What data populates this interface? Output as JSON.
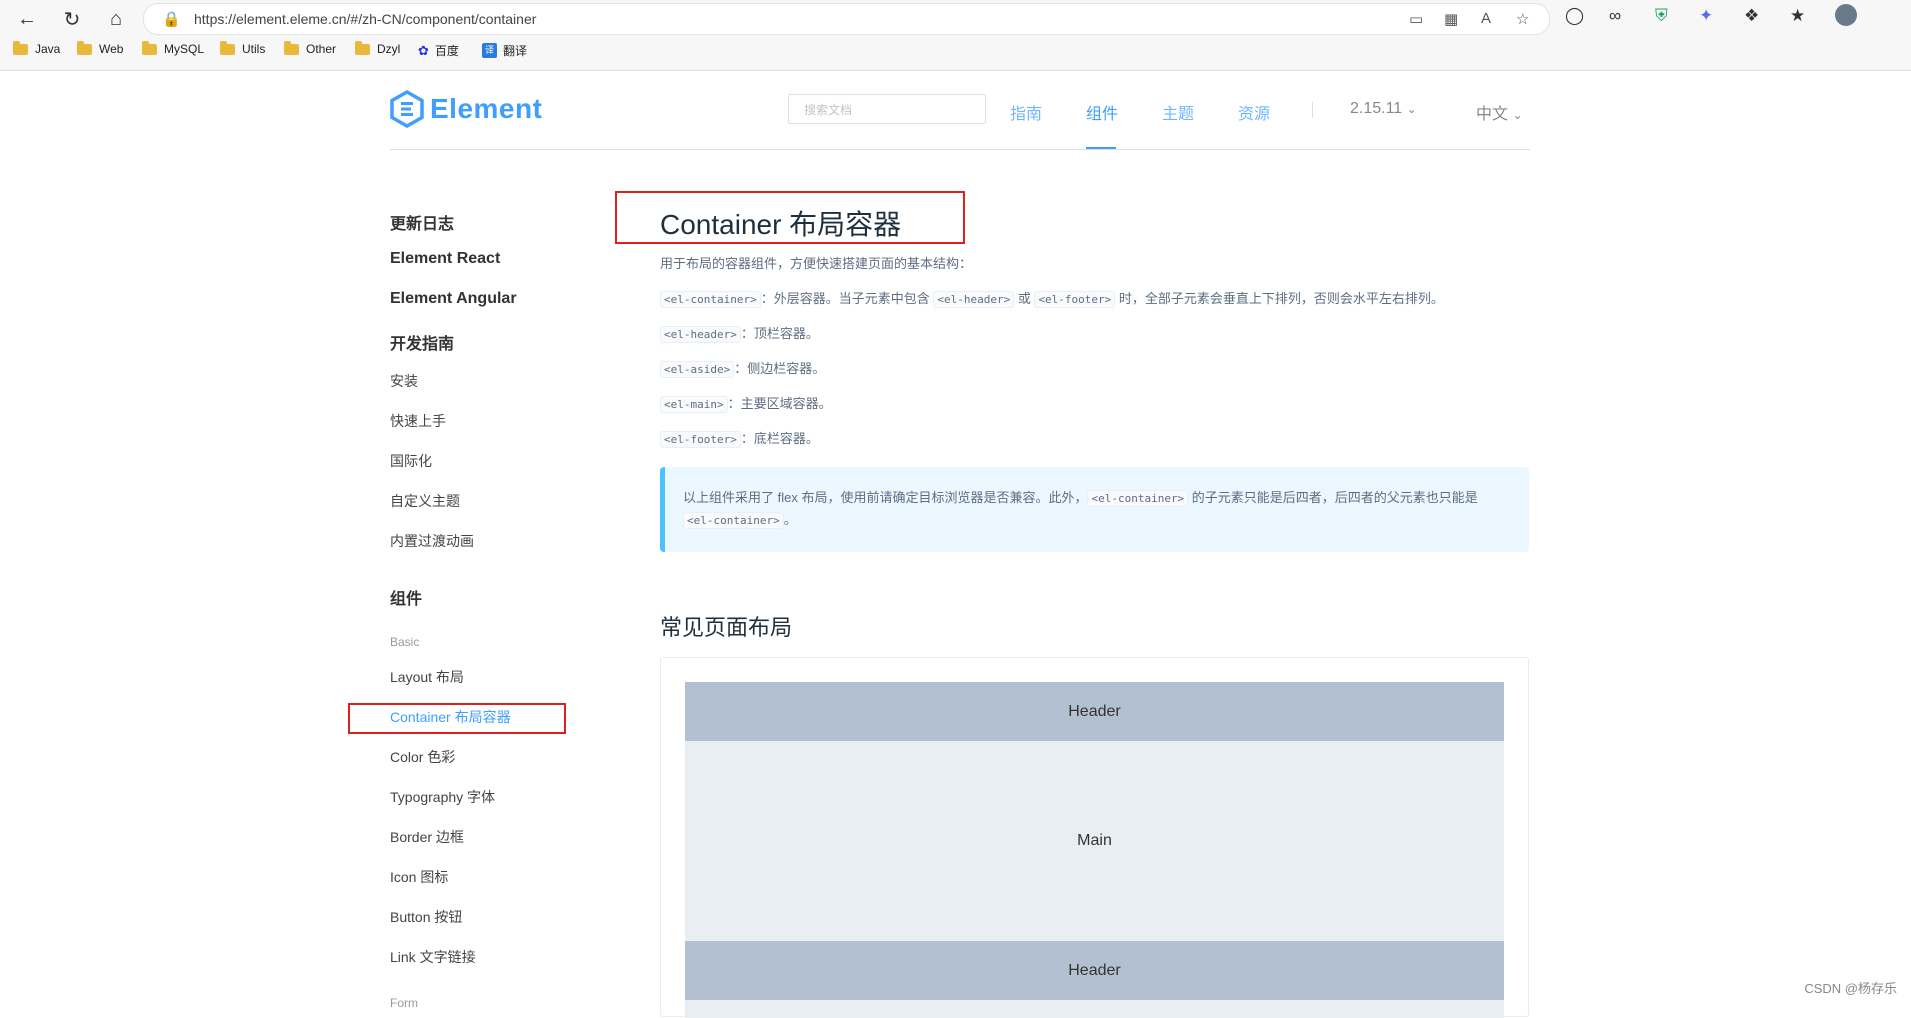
{
  "browser": {
    "url": "https://element.eleme.cn/#/zh-CN/component/container",
    "bookmarks": [
      {
        "label": "Java",
        "icon": "folder-icon"
      },
      {
        "label": "Web",
        "icon": "folder-icon"
      },
      {
        "label": "MySQL",
        "icon": "folder-icon"
      },
      {
        "label": "Utils",
        "icon": "folder-icon"
      },
      {
        "label": "Other",
        "icon": "folder-icon"
      },
      {
        "label": "Dzyl",
        "icon": "folder-icon"
      },
      {
        "label": "百度",
        "icon": "baidu-icon"
      },
      {
        "label": "翻译",
        "icon": "translate-icon"
      }
    ]
  },
  "site": {
    "logo_text": "Element",
    "search_placeholder": "搜索文档",
    "nav": [
      "指南",
      "组件",
      "主题",
      "资源"
    ],
    "active_nav": "组件",
    "version": "2.15.11",
    "language": "中文"
  },
  "sidebar": {
    "headings": [
      "更新日志",
      "Element React",
      "Element Angular",
      "开发指南"
    ],
    "guide_items": [
      "安装",
      "快速上手",
      "国际化",
      "自定义主题",
      "内置过渡动画"
    ],
    "component_heading": "组件",
    "group_basic": "Basic",
    "basic_items": [
      "Layout 布局",
      "Container 布局容器",
      "Color 色彩",
      "Typography 字体",
      "Border 边框",
      "Icon 图标",
      "Button 按钮",
      "Link 文字链接"
    ],
    "active_item": "Container 布局容器",
    "group_form": "Form"
  },
  "content": {
    "title": "Container 布局容器",
    "intro": "用于布局的容器组件，方便快速搭建页面的基本结构：",
    "items": [
      {
        "code": "<el-container>",
        "text": "：外层容器。当子元素中包含 ",
        "code2": "<el-header>",
        "text2": " 或 ",
        "code3": "<el-footer>",
        "text3": " 时，全部子元素会垂直上下排列，否则会水平左右排列。"
      },
      {
        "code": "<el-header>",
        "text": "：顶栏容器。"
      },
      {
        "code": "<el-aside>",
        "text": "：侧边栏容器。"
      },
      {
        "code": "<el-main>",
        "text": "：主要区域容器。"
      },
      {
        "code": "<el-footer>",
        "text": "：底栏容器。"
      }
    ],
    "tip": {
      "text1": "以上组件采用了 flex 布局，使用前请确定目标浏览器是否兼容。此外，",
      "code1": "<el-container>",
      "text2": " 的子元素只能是后四者，后四者的父元素也只能是 ",
      "code2": "<el-container>",
      "text3": "。"
    },
    "section_title": "常见页面布局",
    "demo": {
      "header1": "Header",
      "main": "Main",
      "header2": "Header"
    }
  },
  "watermark": "CSDN @杨存乐",
  "highlight_color": "#e02020",
  "accent_color": "#409eff"
}
